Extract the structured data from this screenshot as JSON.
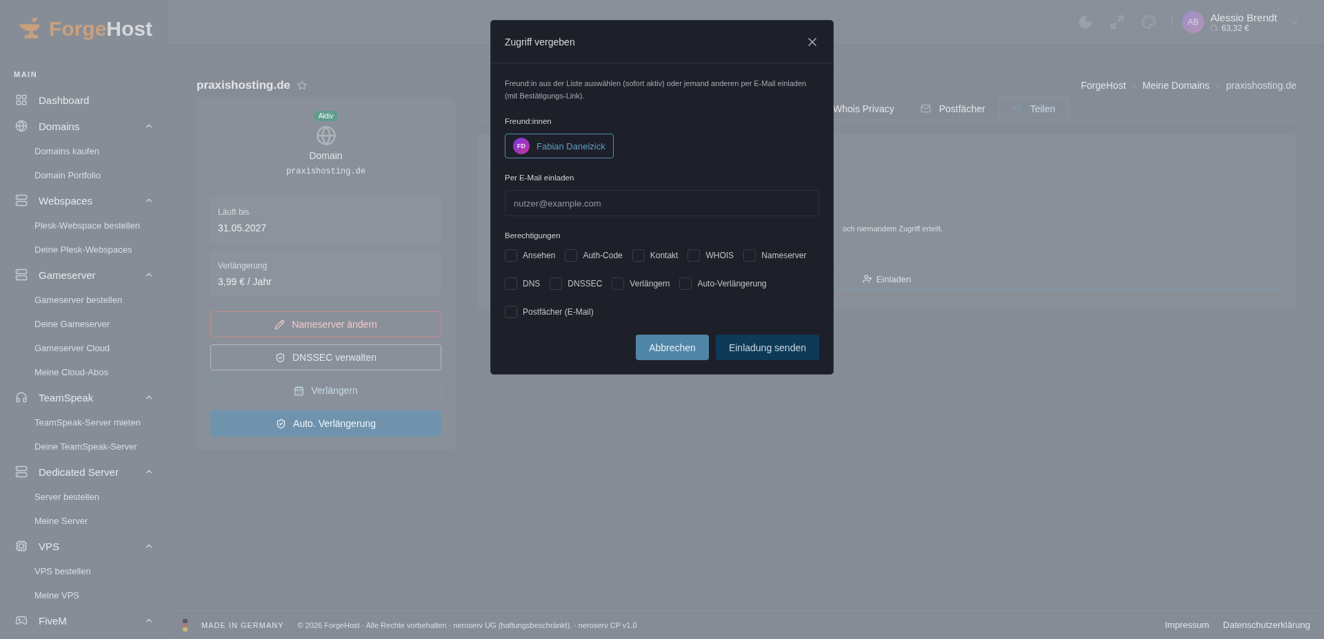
{
  "sidebar": {
    "logo": {
      "part_1": "Forge",
      "part_2": "Host"
    },
    "section": "MAIN",
    "items": [
      {
        "label": "Dashboard"
      },
      {
        "label": "Domains",
        "expanded": true,
        "children": [
          {
            "label": "Domains kaufen"
          },
          {
            "label": "Domain Portfolio"
          }
        ]
      },
      {
        "label": "Webspaces",
        "expanded": true,
        "children": [
          {
            "label": "Plesk-Webspace bestellen"
          },
          {
            "label": "Deine Plesk-Webspaces"
          }
        ]
      },
      {
        "label": "Gameserver",
        "expanded": true,
        "children": [
          {
            "label": "Gameserver bestellen"
          },
          {
            "label": "Deine Gameserver"
          },
          {
            "label": "Gameserver Cloud"
          },
          {
            "label": "Meine Cloud-Abos"
          }
        ]
      },
      {
        "label": "TeamSpeak",
        "expanded": true,
        "children": [
          {
            "label": "TeamSpeak-Server mieten"
          },
          {
            "label": "Deine TeamSpeak-Server"
          }
        ]
      },
      {
        "label": "Dedicated Server",
        "expanded": true,
        "children": [
          {
            "label": "Server bestellen"
          },
          {
            "label": "Meine Server"
          }
        ]
      },
      {
        "label": "VPS",
        "expanded": true,
        "children": [
          {
            "label": "VPS bestellen"
          },
          {
            "label": "Meine VPS"
          }
        ]
      },
      {
        "label": "FiveM",
        "expanded": true
      }
    ]
  },
  "header": {
    "user": {
      "initials": "AB",
      "name": "Alessio Brendt",
      "balance": "63,32 €"
    }
  },
  "page": {
    "title": "praxishosting.de",
    "breadcrumb": [
      "ForgeHost",
      "Meine Domains",
      "praxishosting.de"
    ]
  },
  "domain_card": {
    "badge": "Aktiv",
    "type": "Domain",
    "domain": "praxishosting.de",
    "info": [
      {
        "label": "Läuft bis",
        "value": "31.05.2027"
      },
      {
        "label": "Verlängerung",
        "value": "3,99 € / Jahr"
      }
    ],
    "actions": [
      {
        "label": "Nameserver ändern",
        "kind": "danger"
      },
      {
        "label": "DNSSEC verwalten",
        "kind": "outline"
      },
      {
        "label": "Verlängern",
        "kind": "faint"
      },
      {
        "label": "Auto. Verlängerung",
        "kind": "filled"
      }
    ]
  },
  "tabs": [
    {
      "label": "Whois Privacy",
      "selected": false
    },
    {
      "label": "Postfächer",
      "selected": false
    },
    {
      "label": "Teilen",
      "selected": true
    }
  ],
  "share_panel": {
    "empty_text": "och niemandem Zugriff erteilt.",
    "invite_button": "Einladen"
  },
  "dialog": {
    "title": "Zugriff vergeben",
    "intro": "Freund:in aus der Liste auswählen (sofort aktiv) oder jemand anderen per E-Mail einladen (mit Bestätigungs-Link).",
    "friends_label": "Freund:innen",
    "friends": [
      {
        "initials": "FD",
        "name": "Fabian Danelzick",
        "selected": false
      }
    ],
    "email_label": "Per E-Mail einladen",
    "email_placeholder": "nutzer@example.com",
    "permissions_label": "Berechtigungen",
    "permissions": [
      {
        "label": "Ansehen",
        "checked": false
      },
      {
        "label": "Auth-Code",
        "checked": false
      },
      {
        "label": "Kontakt",
        "checked": false
      },
      {
        "label": "WHOIS",
        "checked": false
      },
      {
        "label": "Nameserver",
        "checked": false
      },
      {
        "label": "DNS",
        "checked": false
      },
      {
        "label": "DNSSEC",
        "checked": false
      },
      {
        "label": "Verlängern",
        "checked": false
      },
      {
        "label": "Auto-Verlängerung",
        "checked": false
      },
      {
        "label": "Postfächer (E-Mail)",
        "checked": false
      }
    ],
    "buttons": [
      {
        "label": "Abbrechen",
        "kind": "secondary"
      },
      {
        "label": "Einladung senden",
        "kind": "primary"
      }
    ]
  },
  "footer": {
    "made_in": "MADE IN GERMANY",
    "copyright": "© 2026 ForgeHost · Alle Rechte vorbehalten · neroserv UG (haftungsbeschränkt). · neroserv CP v1.0",
    "links": [
      "Impressum",
      "Datenschutzerklärung"
    ]
  }
}
